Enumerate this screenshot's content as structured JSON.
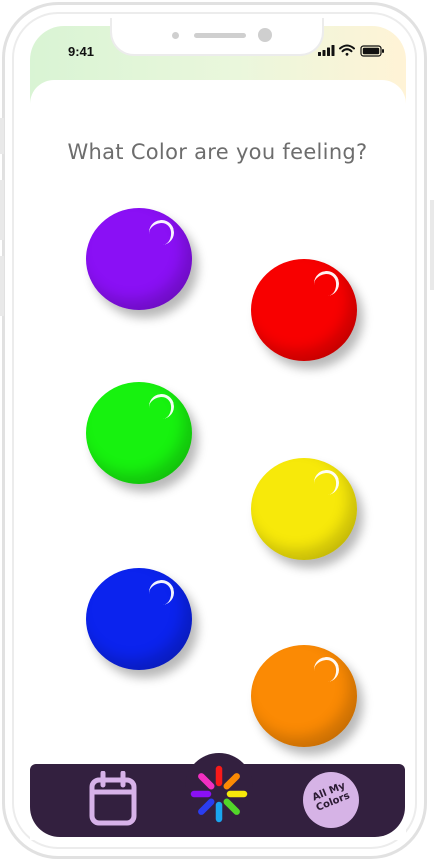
{
  "status_bar": {
    "time": "9:41"
  },
  "main": {
    "prompt": "What Color are you feeling?",
    "color_options": [
      {
        "name": "purple",
        "color": "#8a10f5"
      },
      {
        "name": "red",
        "color": "#f80000"
      },
      {
        "name": "green",
        "color": "#17f20f"
      },
      {
        "name": "yellow",
        "color": "#f7e90a"
      },
      {
        "name": "blue",
        "color": "#0b23ee"
      },
      {
        "name": "orange",
        "color": "#fb8a04"
      }
    ]
  },
  "tab_bar": {
    "background": "#33203f",
    "items": [
      {
        "icon": "calendar-icon"
      },
      {
        "icon": "color-wheel-icon"
      },
      {
        "icon": "logo",
        "label_line1": "All My",
        "label_line2": "Colors"
      }
    ]
  }
}
